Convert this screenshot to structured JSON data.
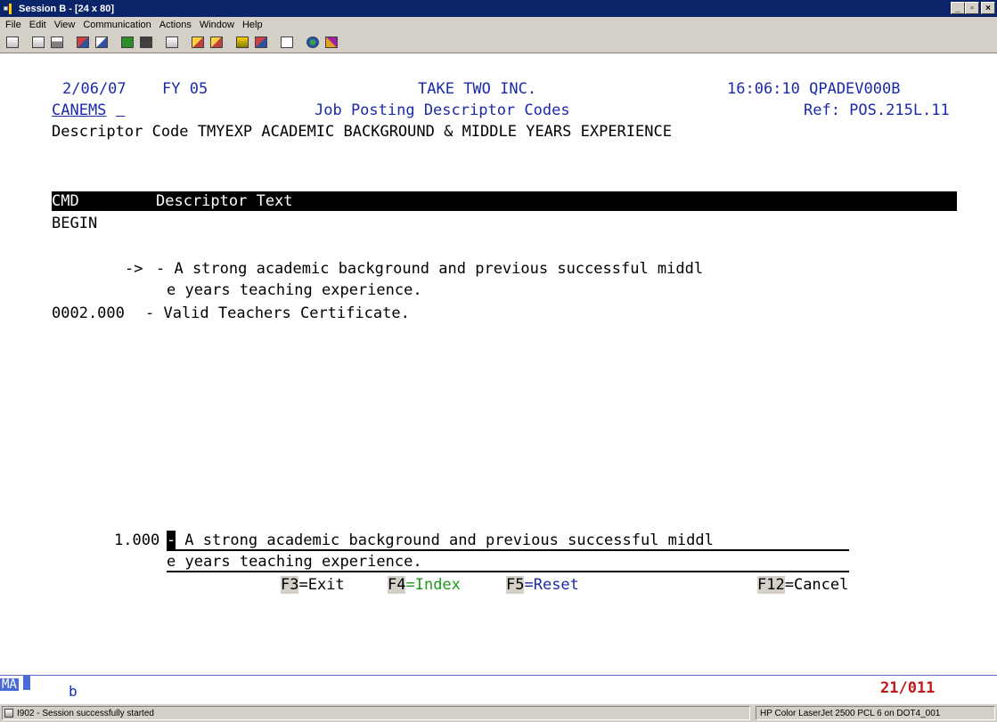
{
  "window": {
    "title": "Session B - [24 x 80]",
    "buttons": {
      "minimize": "_",
      "maximize": "▫",
      "close": "×"
    }
  },
  "menu": {
    "items": [
      "File",
      "Edit",
      "View",
      "Communication",
      "Actions",
      "Window",
      "Help"
    ]
  },
  "toolbar": {
    "icons": [
      "print-screen-icon",
      "copy-icon",
      "paste-icon",
      "send-file-icon",
      "receive-file-icon",
      "display-icon",
      "keyboard-map-icon",
      "macro-icon",
      "play-macro-icon",
      "record-macro-icon",
      "stop-macro-icon",
      "pause-macro-icon",
      "clipboard-icon",
      "customize-icon",
      "help-icon"
    ]
  },
  "screen": {
    "date": "2/06/07",
    "fy": "FY 05",
    "company": "TAKE TWO INC.",
    "time_program": "16:06:10 QPADEV000B",
    "user": "CANEMS",
    "screen_title": "Job Posting Descriptor Codes",
    "ref": "Ref: POS.215L.11",
    "descriptor_line": "Descriptor Code TMYEXP ACADEMIC BACKGROUND & MIDDLE YEARS EXPERIENCE",
    "column_headers": {
      "cmd": "CMD",
      "text": "Descriptor Text"
    },
    "begin": "BEGIN",
    "lines": [
      {
        "cmd": "->",
        "text": "- A strong academic background and previous successful middl"
      },
      {
        "cmd": "",
        "text": "e years teaching experience."
      },
      {
        "cmd": "0002.000",
        "text": "- Valid Teachers Certificate."
      }
    ],
    "input": {
      "seq": "1.000",
      "cursor": "-",
      "line1": " A strong academic background and previous successful middl",
      "line2": "e years teaching experience."
    },
    "function_keys": [
      {
        "key": "F3",
        "label": "=Exit",
        "color": "#000000"
      },
      {
        "key": "F4",
        "label": "=Index",
        "color": "#1a9a1a"
      },
      {
        "key": "F5",
        "label": "=Reset",
        "color": "#1a2aa8"
      },
      {
        "key": "F12",
        "label": "=Cancel",
        "color": "#000000"
      }
    ]
  },
  "oia": {
    "mode": "MA",
    "indicator": "b",
    "cursor_position": "21/011"
  },
  "status": {
    "message": "I902 - Session successfully started",
    "printer": "HP Color LaserJet 2500 PCL 6 on DOT4_001"
  }
}
